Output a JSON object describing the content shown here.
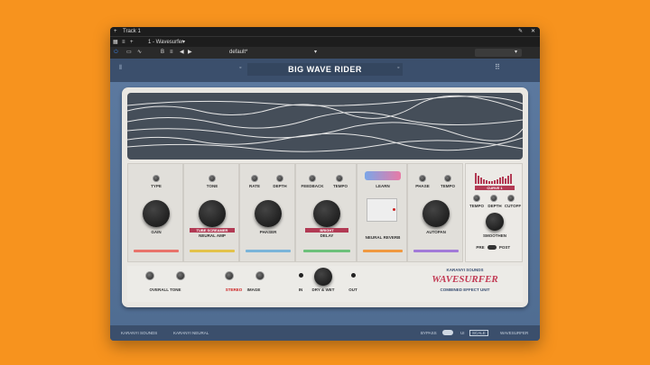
{
  "window": {
    "track_label": "Track 1",
    "plugin_name": "1 - Wavesurfer",
    "preset": "default*"
  },
  "plugin": {
    "title": "BIG WAVE RIDER"
  },
  "modules": [
    {
      "labels": [
        "TYPE",
        "GAIN"
      ]
    },
    {
      "labels": [
        "TONE",
        "TUBE SCREAMER",
        "NEURAL AMP"
      ]
    },
    {
      "labels": [
        "RATE",
        "DEPTH",
        "PHASER"
      ]
    },
    {
      "labels": [
        "FEEDBACK",
        "TEMPO",
        "BRIGHT",
        "DELAY"
      ]
    },
    {
      "labels": [
        "LEARN",
        "NEURAL REVERB"
      ]
    },
    {
      "labels": [
        "PHASE",
        "TEMPO",
        "AUTOPAN"
      ]
    }
  ],
  "side": {
    "curve_label": "CURVE 1",
    "labels": [
      "TEMPO",
      "DEPTH",
      "CUTOFF",
      "SMOOTHEN",
      "PRE",
      "POST"
    ]
  },
  "bottom": {
    "overall_tone": "OVERALL TONE",
    "stereo": "STEREO",
    "image": "IMAGE",
    "in": "IN",
    "dry_wet": "DRY & WET",
    "out": "OUT"
  },
  "brand": {
    "company": "KARANYI SOUNDS",
    "product": "WAVESURFER",
    "subtitle": "COMBINED EFFECT UNIT"
  },
  "footer": {
    "left1": "KARANYI SOUNDS",
    "left2": "KARANYI NEURAL",
    "bypass": "BYPASS",
    "scale": "SCALE",
    "scale_prefix": "UI",
    "brand": "WAVESURFER"
  }
}
